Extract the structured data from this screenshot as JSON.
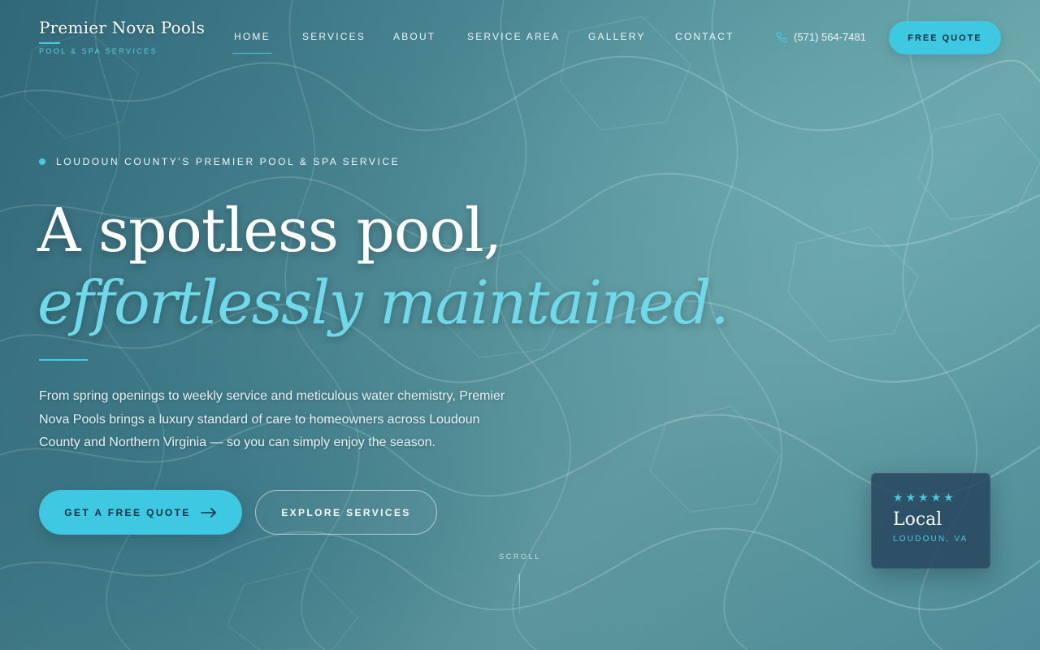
{
  "brand": {
    "name": "Premier Nova Pools",
    "tagline": "POOL & SPA SERVICES"
  },
  "nav": {
    "items": [
      {
        "label": "HOME",
        "active": true
      },
      {
        "label": "SERVICES",
        "active": false
      },
      {
        "label": "ABOUT",
        "active": false
      },
      {
        "label": "SERVICE AREA",
        "active": false
      },
      {
        "label": "GALLERY",
        "active": false
      },
      {
        "label": "CONTACT",
        "active": false
      }
    ],
    "phone": "(571) 564-7481",
    "cta_label": "FREE QUOTE"
  },
  "hero": {
    "eyebrow": "LOUDOUN COUNTY'S PREMIER POOL & SPA SERVICE",
    "headline_line1": "A spotless pool,",
    "headline_line2": "effortlessly maintained.",
    "intro": "From spring openings to weekly service and meticulous water chemistry, Premier Nova Pools brings a luxury standard of care to homeowners across Loudoun County and Northern Virginia — so you can simply enjoy the season.",
    "primary_cta": "GET A FREE QUOTE",
    "secondary_cta": "EXPLORE SERVICES",
    "scroll_label": "SCROLL"
  },
  "rating_card": {
    "stars": 5,
    "title": "Local",
    "subtitle": "LOUDOUN, VA"
  },
  "colors": {
    "accent": "#3fc8e2",
    "headline_italic": "#6fd9ea",
    "water": "#5a9aa3",
    "card": "#24425c"
  },
  "icons": {
    "phone": "phone-icon",
    "arrow": "arrow-right-icon",
    "star": "star-icon"
  }
}
